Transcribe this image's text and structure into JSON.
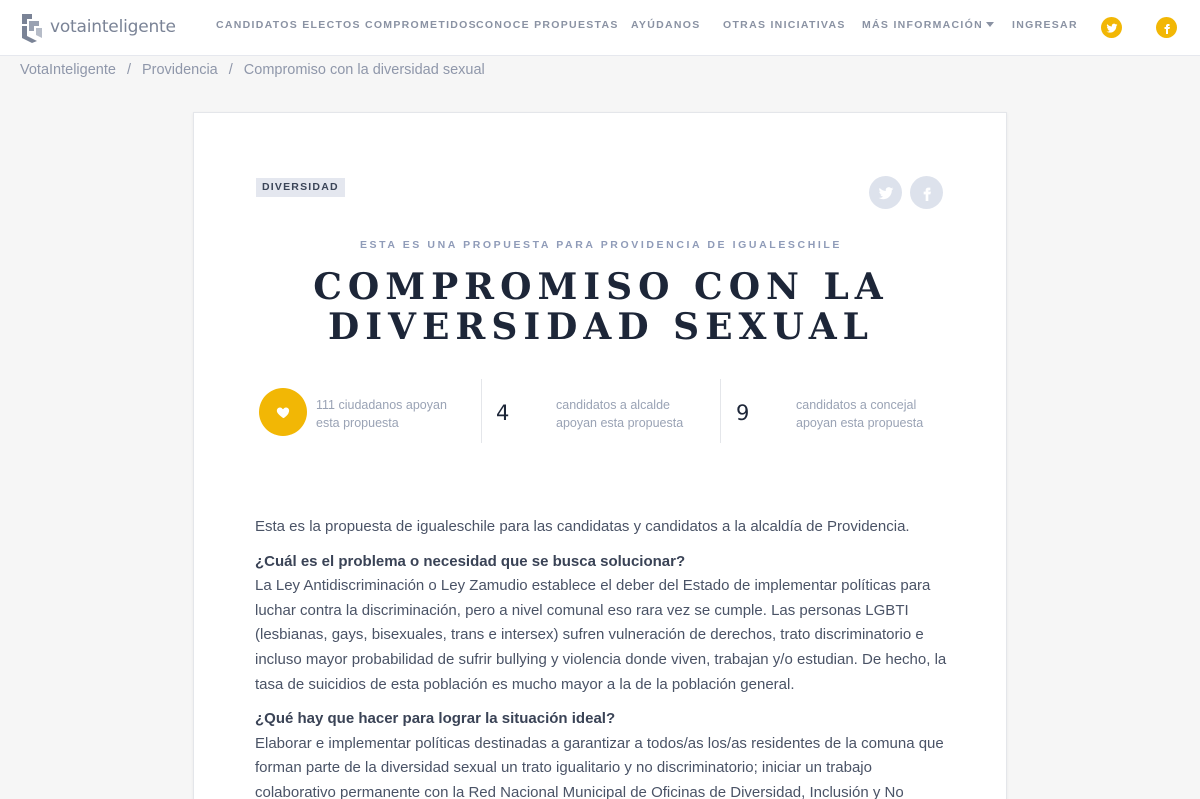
{
  "header": {
    "logo_text": "votainteligente",
    "nav": [
      {
        "label": "CANDIDATOS ELECTOS COMPROMETIDOS"
      },
      {
        "label": "CONOCE PROPUESTAS"
      },
      {
        "label": "AYÚDANOS"
      },
      {
        "label": "OTRAS INICIATIVAS"
      },
      {
        "label": "MÁS INFORMACIÓN"
      },
      {
        "label": "INGRESAR"
      }
    ],
    "social": [
      "twitter-icon",
      "facebook-icon"
    ]
  },
  "breadcrumb": {
    "items": [
      "VotaInteligente",
      "Providencia"
    ],
    "current": "Compromiso con la diversidad sexual",
    "separator": "/"
  },
  "proposal": {
    "tag": "DIVERSIDAD",
    "kicker": "ESTA ES UNA PROPUESTA PARA PROVIDENCIA DE IGUALESCHILE",
    "title_line1": "COMPROMISO CON LA",
    "title_line2": "DIVERSIDAD SEXUAL",
    "stats": {
      "supporters_text_1": "111 ciudadanos apoyan",
      "supporters_text_2": "esta propuesta",
      "mayor_count": "4",
      "mayor_text_1": "candidatos a alcalde",
      "mayor_text_2": "apoyan esta propuesta",
      "council_count": "9",
      "council_text_1": "candidatos a concejal",
      "council_text_2": "apoyan esta propuesta"
    },
    "intro": "Esta es la propuesta de igualeschile para las candidatas y candidatos a la alcaldía de Providencia.",
    "q1": "¿Cuál es el problema o necesidad que se busca solucionar?",
    "a1": "La Ley Antidiscriminación o Ley Zamudio establece el deber del Estado de implementar políticas para luchar contra la discriminación, pero a nivel comunal eso rara vez se cumple. Las personas LGBTI (lesbianas, gays, bisexuales, trans e intersex) sufren vulneración de derechos, trato discriminatorio e incluso mayor probabilidad de sufrir bullying y violencia donde viven, trabajan y/o estudian. De hecho, la tasa de suicidios de esta población es mucho mayor a la de la población general.",
    "q2": "¿Qué hay que hacer para lograr la situación ideal?",
    "a2": "Elaborar e implementar políticas destinadas a garantizar a todos/as los/as residentes de la comuna que forman parte de la diversidad sexual un trato igualitario y no discriminatorio; iniciar un trabajo colaborativo permanente con la Red Nacional Municipal de Oficinas de Diversidad, Inclusión y No"
  },
  "colors": {
    "accent": "#f2b705",
    "title": "#1d2638",
    "muted": "#8f97aa"
  }
}
